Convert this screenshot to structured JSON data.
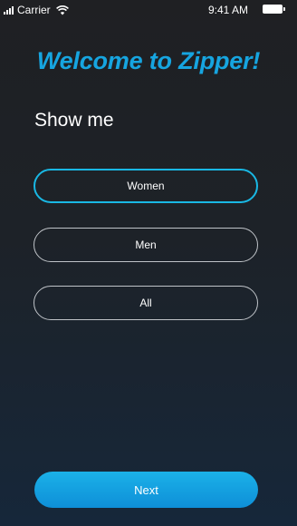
{
  "status_bar": {
    "carrier": "Carrier",
    "time": "9:41 AM"
  },
  "header": {
    "title": "Welcome to Zipper!",
    "subtitle": "Show me"
  },
  "options": [
    {
      "label": "Women",
      "selected": true
    },
    {
      "label": "Men",
      "selected": false
    },
    {
      "label": "All",
      "selected": false
    }
  ],
  "actions": {
    "next_label": "Next"
  },
  "colors": {
    "accent": "#16a5e0",
    "selected_border": "#19b8e4",
    "button_gradient_top": "#1bb1e8",
    "button_gradient_bottom": "#0e8fd8"
  },
  "icons": [
    "signal-icon",
    "wifi-icon",
    "battery-icon"
  ]
}
